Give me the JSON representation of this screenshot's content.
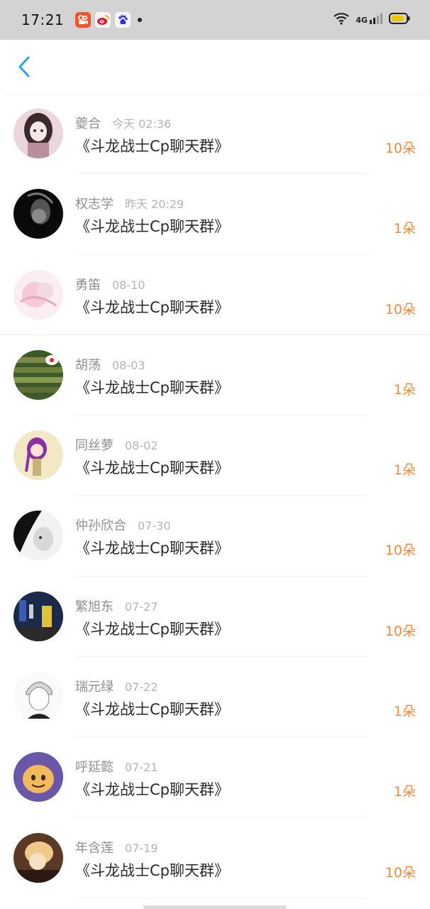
{
  "status_bar": {
    "time": "17:21",
    "apps": [
      "kuaishou-icon",
      "weibo-icon",
      "baidu-icon"
    ],
    "network": "4G"
  },
  "header": {
    "back_icon": "chevron-left-icon"
  },
  "colors": {
    "accent": "#2aa6e8",
    "flowers": "#ef8a3f",
    "name": "#8f8f8f",
    "time": "#b5b5b5"
  },
  "items": [
    {
      "name": "夔合",
      "time": "今天 02:36",
      "message": "《斗龙战士Cp聊天群》",
      "flowers": "10朵"
    },
    {
      "name": "权志学",
      "time": "昨天 20:29",
      "message": "《斗龙战士Cp聊天群》",
      "flowers": "1朵"
    },
    {
      "name": "勇笛",
      "time": "08-10",
      "message": "《斗龙战士Cp聊天群》",
      "flowers": "10朵"
    },
    {
      "name": "胡荡",
      "time": "08-03",
      "message": "《斗龙战士Cp聊天群》",
      "flowers": "1朵"
    },
    {
      "name": "同丝萝",
      "time": "08-02",
      "message": "《斗龙战士Cp聊天群》",
      "flowers": "1朵"
    },
    {
      "name": "仲孙欣合",
      "time": "07-30",
      "message": "《斗龙战士Cp聊天群》",
      "flowers": "10朵"
    },
    {
      "name": "繁旭东",
      "time": "07-27",
      "message": "《斗龙战士Cp聊天群》",
      "flowers": "10朵"
    },
    {
      "name": "瑞元绿",
      "time": "07-22",
      "message": "《斗龙战士Cp聊天群》",
      "flowers": "1朵"
    },
    {
      "name": "呼延懿",
      "time": "07-21",
      "message": "《斗龙战士Cp聊天群》",
      "flowers": "1朵"
    },
    {
      "name": "年含莲",
      "time": "07-19",
      "message": "《斗龙战士Cp聊天群》",
      "flowers": "10朵"
    }
  ]
}
